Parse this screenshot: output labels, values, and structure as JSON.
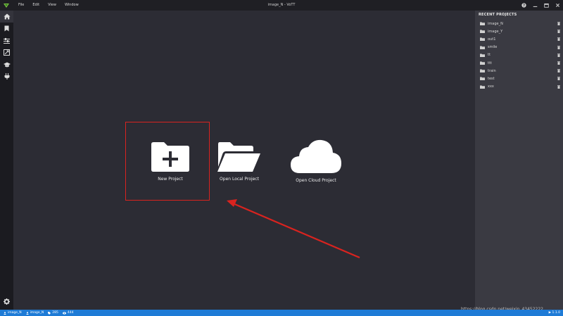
{
  "window": {
    "title": "image_N - VoTT",
    "menu": [
      "File",
      "Edit",
      "View",
      "Window"
    ]
  },
  "sidebar": {
    "items": [
      {
        "icon": "home-icon"
      },
      {
        "icon": "bookmark-icon"
      },
      {
        "icon": "sliders-icon"
      },
      {
        "icon": "export-icon"
      },
      {
        "icon": "graduation-cap-icon"
      },
      {
        "icon": "plug-icon"
      }
    ],
    "bottom_icon": "gear-icon"
  },
  "main": {
    "actions": [
      {
        "label": "New Project",
        "icon": "new-folder-icon"
      },
      {
        "label": "Open Local Project",
        "icon": "open-folder-icon"
      },
      {
        "label": "Open Cloud Project",
        "icon": "cloud-icon"
      }
    ]
  },
  "recent": {
    "title": "RECENT PROJECTS",
    "items": [
      "image_N",
      "image_Y",
      "out1",
      "smile",
      "tt",
      "ttt",
      "train",
      "test",
      "xxx"
    ]
  },
  "statusbar": {
    "source": "image_N",
    "target": "image_N",
    "tags": "285",
    "visited": "444",
    "right_text": "▶ 1.1.0"
  },
  "watermark": "https://blog.csdn.net/weixin_43452222",
  "colors": {
    "accent": "#1e7bd6",
    "highlight": "#d9231f"
  }
}
